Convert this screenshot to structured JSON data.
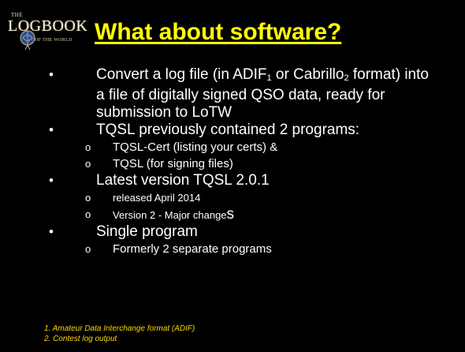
{
  "logo": {
    "top_text": "THE",
    "main_text": "LOGBOOK",
    "sub_text": "OF THE WORLD"
  },
  "title": "What about software?",
  "bullets": [
    {
      "text_before": "Convert a log file (in ADIF",
      "sup1": "1",
      "text_mid": " or Cabrillo",
      "sup2": "2",
      "text_after": " format) into a file of digitally signed QSO data, ready for submission to LoTW"
    },
    {
      "text": "TQSL previously contained 2 programs:",
      "subs": [
        "TQSL-Cert (listing your certs) &",
        "TQSL (for signing files)"
      ]
    },
    {
      "text": "Latest version TQSL 2.0.1",
      "subs": [
        "released April 2014",
        "Version 2 - Major change"
      ],
      "sub2_suffix": "s"
    },
    {
      "text": "Single program",
      "subs": [
        "Formerly 2 separate programs"
      ]
    }
  ],
  "bullet_char": "•",
  "sub_bullet_char": "o",
  "footnotes": [
    "1.  Amateur Data Interchange format (ADIF)",
    "2.  Contest log output"
  ],
  "colors": {
    "background": "#000000",
    "title": "#ffff00",
    "body_text": "#ffffff",
    "footnotes": "#ffd700"
  }
}
